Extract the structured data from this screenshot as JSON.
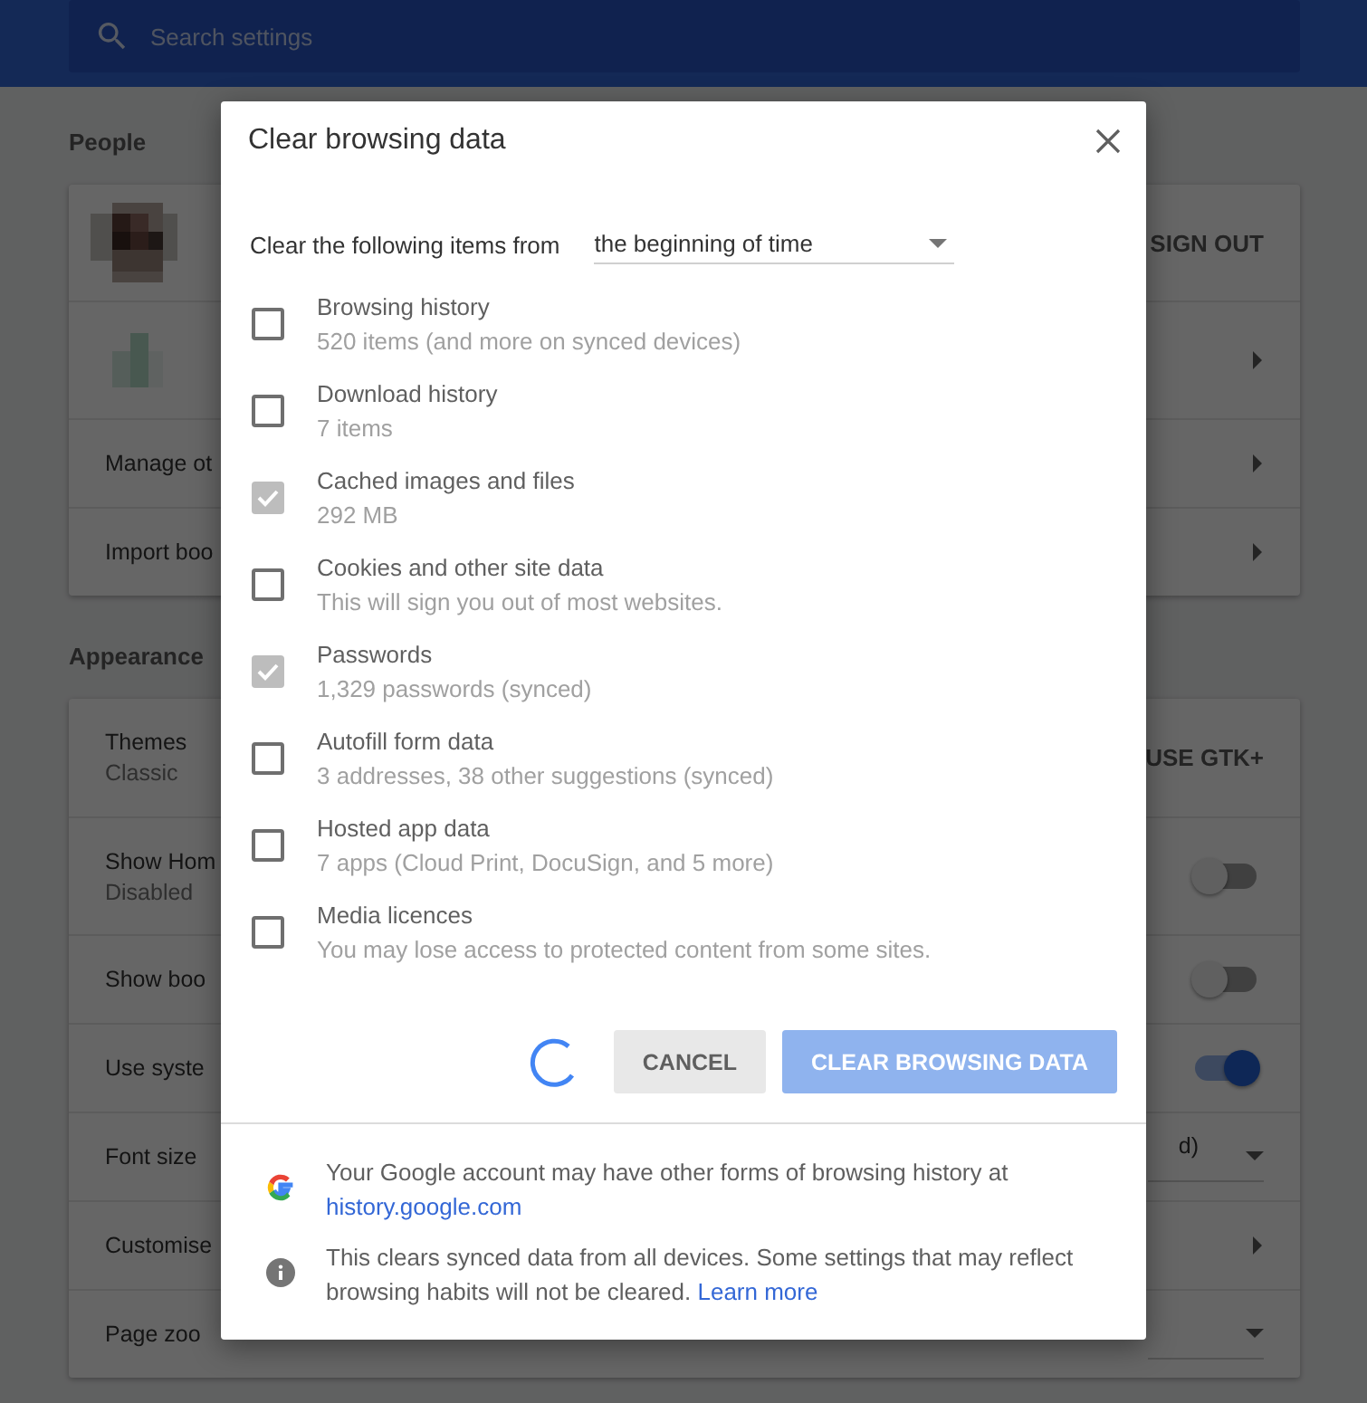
{
  "search": {
    "placeholder": "Search settings"
  },
  "sections": [
    {
      "title": "People",
      "rows": [
        {
          "kind": "profile",
          "action": "SIGN OUT"
        },
        {
          "kind": "sync"
        },
        {
          "kind": "link",
          "label": "Manage ot"
        },
        {
          "kind": "link",
          "label": "Import boo"
        }
      ]
    },
    {
      "title": "Appearance",
      "rows": [
        {
          "kind": "button",
          "label": "Themes",
          "sublabel": "Classic",
          "action": "USE GTK+"
        },
        {
          "kind": "toggle",
          "label": "Show Hom",
          "sublabel": "Disabled",
          "on": false
        },
        {
          "kind": "toggle",
          "label": "Show boo",
          "on": false
        },
        {
          "kind": "toggle",
          "label": "Use syste",
          "on": true
        },
        {
          "kind": "select",
          "label": "Font size",
          "value": "d)"
        },
        {
          "kind": "link",
          "label": "Customise"
        },
        {
          "kind": "select",
          "label": "Page zoo"
        }
      ]
    }
  ],
  "dialog": {
    "title": "Clear browsing data",
    "range_label": "Clear the following items from",
    "range_value": "the beginning of time",
    "items": [
      {
        "title": "Browsing history",
        "detail": "520 items (and more on synced devices)",
        "checked": false
      },
      {
        "title": "Download history",
        "detail": "7 items",
        "checked": false
      },
      {
        "title": "Cached images and files",
        "detail": "292 MB",
        "checked": true
      },
      {
        "title": "Cookies and other site data",
        "detail": "This will sign you out of most websites.",
        "checked": false
      },
      {
        "title": "Passwords",
        "detail": "1,329 passwords (synced)",
        "checked": true
      },
      {
        "title": "Autofill form data",
        "detail": "3 addresses, 38 other suggestions (synced)",
        "checked": false
      },
      {
        "title": "Hosted app data",
        "detail": "7 apps (Cloud Print, DocuSign, and 5 more)",
        "checked": false
      },
      {
        "title": "Media licences",
        "detail": "You may lose access to protected content from some sites.",
        "checked": false
      }
    ],
    "busy": true,
    "cancel": {
      "label": "CANCEL"
    },
    "confirm": {
      "label": "CLEAR BROWSING DATA",
      "disabled": true
    },
    "notes": [
      {
        "kind": "google",
        "text": "Your Google account may have other forms of browsing history at",
        "link": "history.google.com"
      },
      {
        "kind": "info",
        "text": "This clears synced data from all devices. Some settings that may reflect browsing habits will not be cleared.",
        "link": "Learn more"
      }
    ]
  }
}
